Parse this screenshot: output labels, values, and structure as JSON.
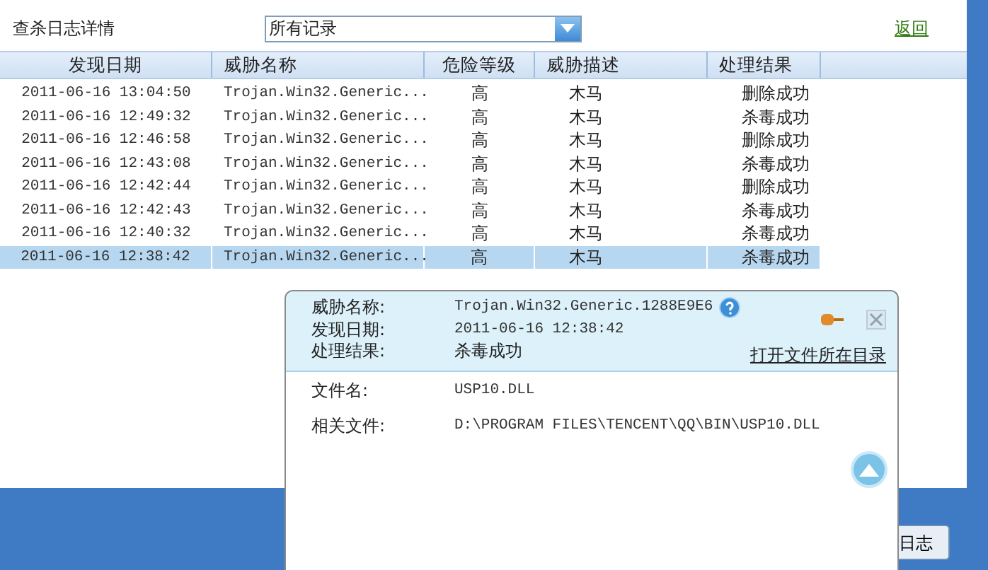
{
  "title": "查杀日志详情",
  "filter": {
    "value": "所有记录"
  },
  "back_link": "返回",
  "table": {
    "columns": [
      "发现日期",
      "威胁名称",
      "危险等级",
      "威胁描述",
      "处理结果"
    ],
    "rows": [
      {
        "date": "2011-06-16 13:04:50",
        "name": "Trojan.Win32.Generic...",
        "level": "高",
        "desc": "木马",
        "result": "删除成功",
        "selected": false
      },
      {
        "date": "2011-06-16 12:49:32",
        "name": "Trojan.Win32.Generic...",
        "level": "高",
        "desc": "木马",
        "result": "杀毒成功",
        "selected": false
      },
      {
        "date": "2011-06-16 12:46:58",
        "name": "Trojan.Win32.Generic...",
        "level": "高",
        "desc": "木马",
        "result": "删除成功",
        "selected": false
      },
      {
        "date": "2011-06-16 12:43:08",
        "name": "Trojan.Win32.Generic...",
        "level": "高",
        "desc": "木马",
        "result": "杀毒成功",
        "selected": false
      },
      {
        "date": "2011-06-16 12:42:44",
        "name": "Trojan.Win32.Generic...",
        "level": "高",
        "desc": "木马",
        "result": "删除成功",
        "selected": false
      },
      {
        "date": "2011-06-16 12:42:43",
        "name": "Trojan.Win32.Generic...",
        "level": "高",
        "desc": "木马",
        "result": "杀毒成功",
        "selected": false
      },
      {
        "date": "2011-06-16 12:40:32",
        "name": "Trojan.Win32.Generic...",
        "level": "高",
        "desc": "木马",
        "result": "杀毒成功",
        "selected": false
      },
      {
        "date": "2011-06-16 12:38:42",
        "name": "Trojan.Win32.Generic...",
        "level": "高",
        "desc": "木马",
        "result": "杀毒成功",
        "selected": true
      }
    ]
  },
  "detail": {
    "header": [
      {
        "label": "威胁名称:",
        "value": "Trojan.Win32.Generic.1288E9E6"
      },
      {
        "label": "发现日期:",
        "value": "2011-06-16 12:38:42"
      },
      {
        "label": "处理结果:",
        "value": "杀毒成功"
      }
    ],
    "open_folder_link": "打开文件所在目录",
    "body": [
      {
        "label": "文件名:",
        "value": "USP10.DLL"
      },
      {
        "label": "相关文件:",
        "value": "D:\\PROGRAM FILES\\TENCENT\\QQ\\BIN\\USP10.DLL"
      }
    ]
  },
  "footer_button": "日志"
}
